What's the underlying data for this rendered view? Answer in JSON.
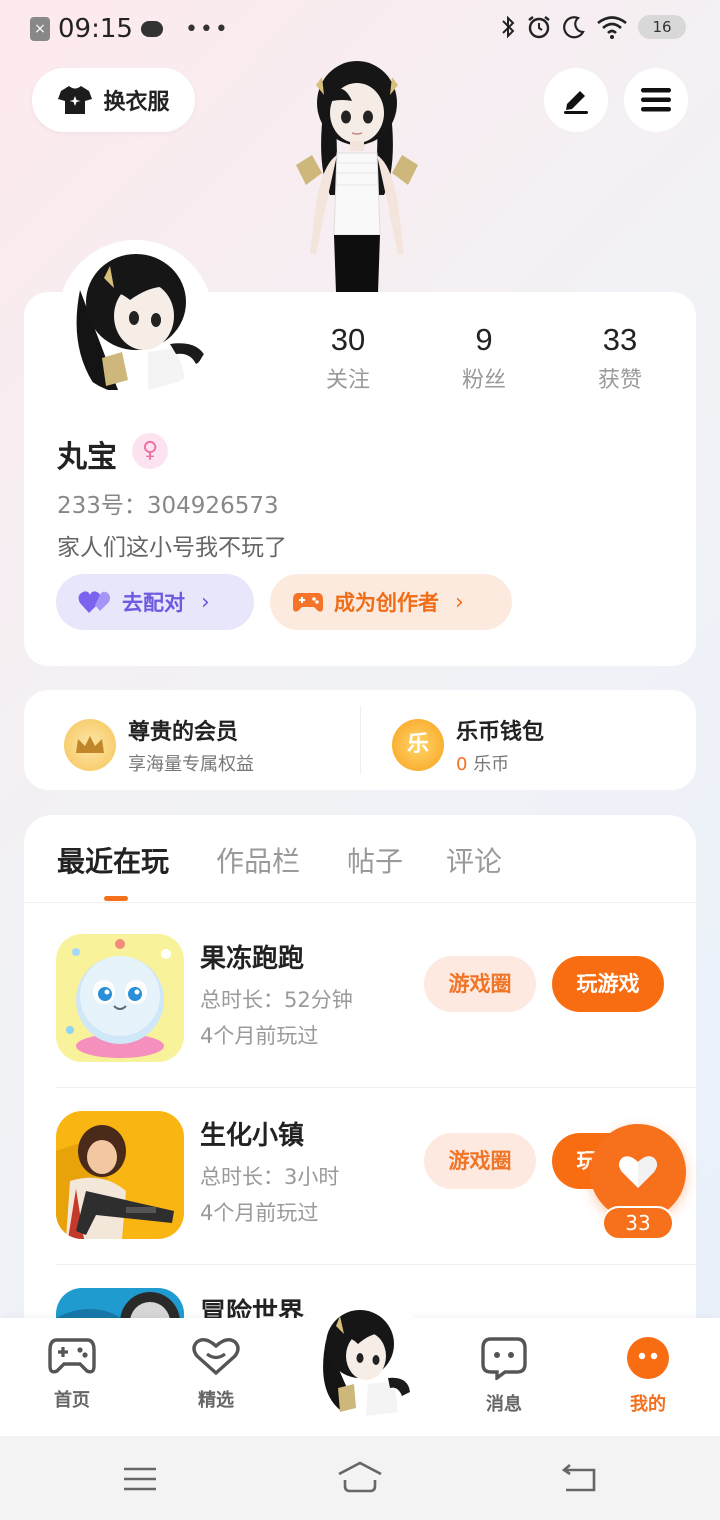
{
  "status_bar": {
    "time": "09:15",
    "dots": "•••",
    "battery": "16",
    "x_icon": "close-square-icon"
  },
  "top_bar": {
    "outfit_label": "换衣服"
  },
  "profile": {
    "stats": [
      {
        "value": "30",
        "label": "关注"
      },
      {
        "value": "9",
        "label": "粉丝"
      },
      {
        "value": "33",
        "label": "获赞"
      }
    ],
    "name": "丸宝",
    "gender_symbol": "♀",
    "uid": "233号：304926573",
    "bio": "家人们这小号我不玩了",
    "match_label": "去配对",
    "creator_label": "成为创作者"
  },
  "member": {
    "vip_title": "尊贵的会员",
    "vip_sub": "享海量专属权益",
    "wallet_title": "乐币钱包",
    "wallet_amount": "0",
    "wallet_unit": "乐币",
    "coin_char": "乐"
  },
  "tabs": [
    "最近在玩",
    "作品栏",
    "帖子",
    "评论"
  ],
  "games": [
    {
      "title": "果冻跑跑",
      "duration": "总时长：52分钟",
      "last": "4个月前玩过",
      "circle_btn": "游戏圈",
      "play_btn": "玩游戏"
    },
    {
      "title": "生化小镇",
      "duration": "总时长：3小时",
      "last": "4个月前玩过",
      "circle_btn": "游戏圈",
      "play_btn": "玩游戏"
    },
    {
      "title": "冒险世界"
    }
  ],
  "like": {
    "count": "33"
  },
  "bottom_nav": [
    {
      "label": "首页"
    },
    {
      "label": "精选"
    },
    {
      "label": "消息"
    },
    {
      "label": "我的"
    }
  ],
  "colors": {
    "accent": "#f96d12",
    "match_purple": "#6c5ae0",
    "gender_pink": "#f06fa8"
  }
}
